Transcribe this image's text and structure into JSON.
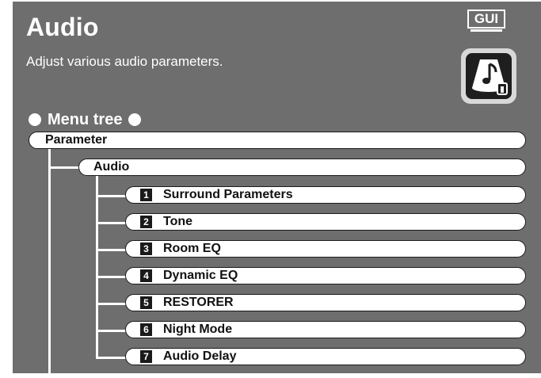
{
  "header": {
    "title": "Audio",
    "subtitle": "Adjust various audio parameters.",
    "gui_badge": "GUI",
    "app_icon": "audio-settings-icon"
  },
  "menu_tree": {
    "heading": "Menu tree",
    "root": "Parameter",
    "level1": "Audio",
    "items": [
      {
        "num": "1",
        "label": "Surround Parameters"
      },
      {
        "num": "2",
        "label": "Tone"
      },
      {
        "num": "3",
        "label": "Room EQ"
      },
      {
        "num": "4",
        "label": "Dynamic EQ"
      },
      {
        "num": "5",
        "label": "RESTORER"
      },
      {
        "num": "6",
        "label": "Night Mode"
      },
      {
        "num": "7",
        "label": "Audio Delay"
      }
    ]
  },
  "colors": {
    "background": "#6e6e6e",
    "text_on_bg": "#ffffff",
    "pill_fill": "#ffffff",
    "pill_border": "#1a1a1a"
  }
}
